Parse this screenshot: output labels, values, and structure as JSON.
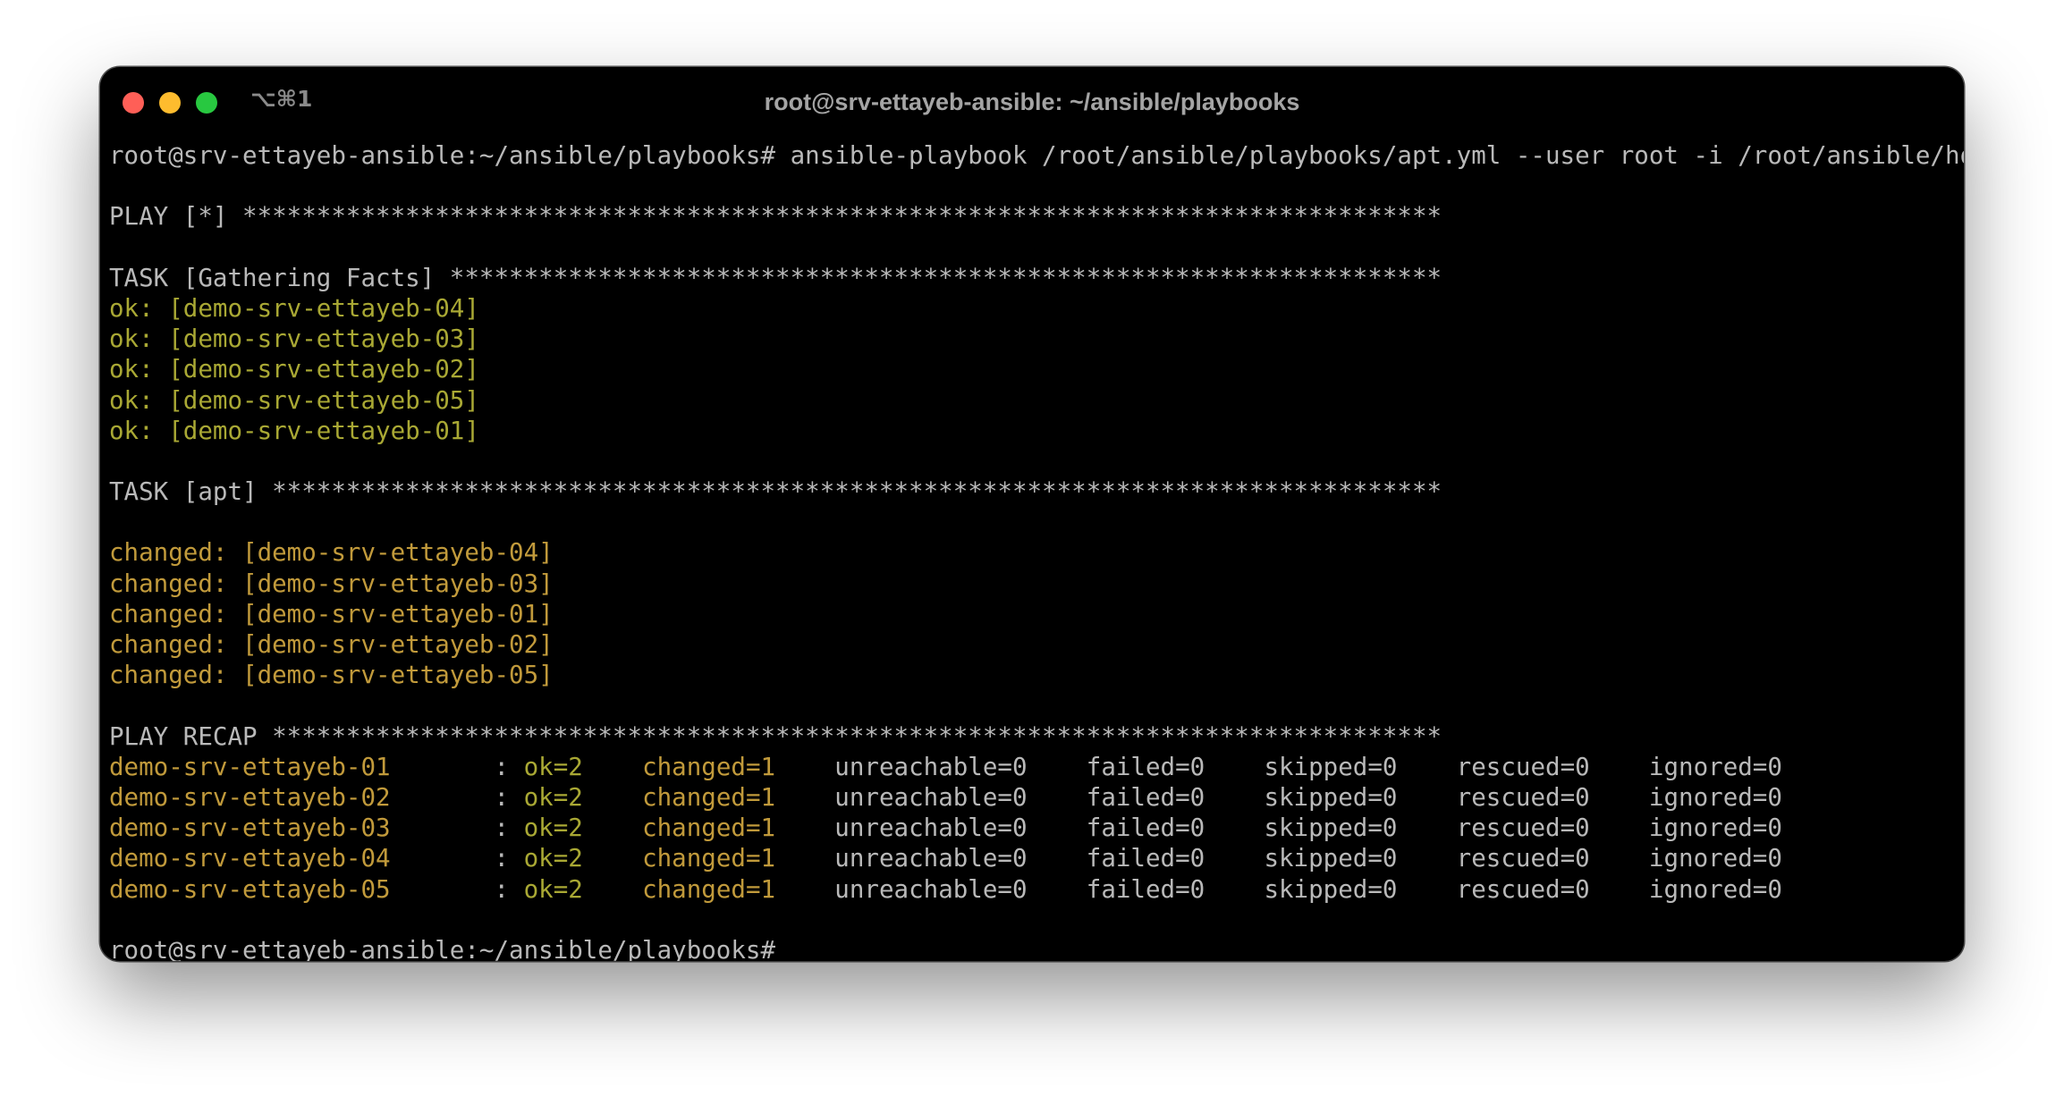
{
  "window": {
    "shortcut": "⌥⌘1",
    "title": "root@srv-ettayeb-ansible: ~/ansible/playbooks"
  },
  "colors": {
    "ok": "#a9a834",
    "changed": "#c19a3b",
    "default_text": "#b9b9b9",
    "background": "#000000"
  },
  "terminal": {
    "command_line": "root@srv-ettayeb-ansible:~/ansible/playbooks# ansible-playbook /root/ansible/playbooks/apt.yml --user root -i /root/ansible/hosts",
    "play_header": "PLAY [*] *********************************************************************************",
    "task_gather_header": "TASK [Gathering Facts] *******************************************************************",
    "gather_results": [
      "ok: [demo-srv-ettayeb-04]",
      "ok: [demo-srv-ettayeb-03]",
      "ok: [demo-srv-ettayeb-02]",
      "ok: [demo-srv-ettayeb-05]",
      "ok: [demo-srv-ettayeb-01]"
    ],
    "task_apt_header": "TASK [apt] *******************************************************************************",
    "apt_results": [
      "changed: [demo-srv-ettayeb-04]",
      "changed: [demo-srv-ettayeb-03]",
      "changed: [demo-srv-ettayeb-01]",
      "changed: [demo-srv-ettayeb-02]",
      "changed: [demo-srv-ettayeb-05]"
    ],
    "recap_header": "PLAY RECAP *******************************************************************************",
    "recap": [
      {
        "host": "demo-srv-ettayeb-01",
        "sep": "       : ",
        "ok": "ok=2",
        "changed": "changed=1",
        "rest": "    unreachable=0    failed=0    skipped=0    rescued=0    ignored=0"
      },
      {
        "host": "demo-srv-ettayeb-02",
        "sep": "       : ",
        "ok": "ok=2",
        "changed": "changed=1",
        "rest": "    unreachable=0    failed=0    skipped=0    rescued=0    ignored=0"
      },
      {
        "host": "demo-srv-ettayeb-03",
        "sep": "       : ",
        "ok": "ok=2",
        "changed": "changed=1",
        "rest": "    unreachable=0    failed=0    skipped=0    rescued=0    ignored=0"
      },
      {
        "host": "demo-srv-ettayeb-04",
        "sep": "       : ",
        "ok": "ok=2",
        "changed": "changed=1",
        "rest": "    unreachable=0    failed=0    skipped=0    rescued=0    ignored=0"
      },
      {
        "host": "demo-srv-ettayeb-05",
        "sep": "       : ",
        "ok": "ok=2",
        "changed": "changed=1",
        "rest": "    unreachable=0    failed=0    skipped=0    rescued=0    ignored=0"
      }
    ],
    "final_prompt": "root@srv-ettayeb-ansible:~/ansible/playbooks#"
  }
}
